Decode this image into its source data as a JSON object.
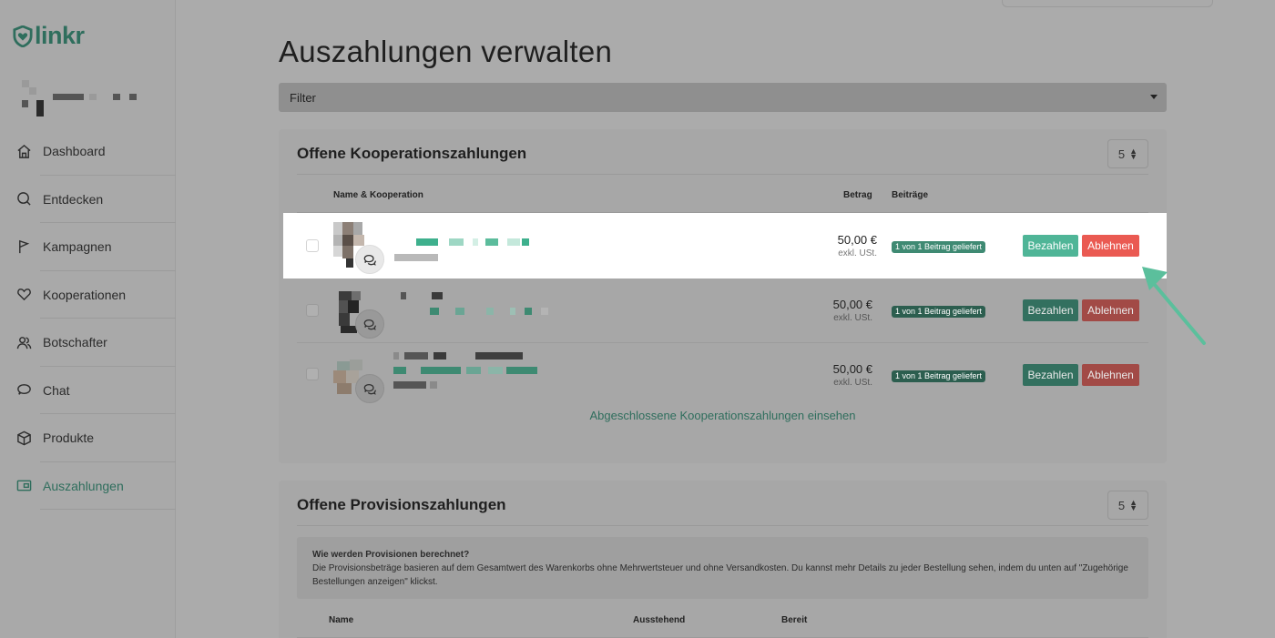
{
  "brand": {
    "name": "linkr",
    "color": "#2f6e5d"
  },
  "nav": [
    {
      "label": "Dashboard",
      "icon": "home-icon"
    },
    {
      "label": "Entdecken",
      "icon": "search-icon"
    },
    {
      "label": "Kampagnen",
      "icon": "flag-icon"
    },
    {
      "label": "Kooperationen",
      "icon": "heart-icon"
    },
    {
      "label": "Botschafter",
      "icon": "users-icon"
    },
    {
      "label": "Chat",
      "icon": "chat-icon"
    },
    {
      "label": "Produkte",
      "icon": "box-icon"
    },
    {
      "label": "Auszahlungen",
      "icon": "wallet-icon",
      "active": true
    }
  ],
  "page": {
    "title": "Auszahlungen verwalten",
    "filter_label": "Filter"
  },
  "cooperation_payments": {
    "title": "Offene Kooperationszahlungen",
    "page_size": "5",
    "headers": {
      "name": "Name & Kooperation",
      "amount": "Betrag",
      "posts": "Beiträge"
    },
    "rows": [
      {
        "amount": "50,00 €",
        "tax_note": "exkl. USt.",
        "posts_badge": "1 von 1 Beitrag geliefert",
        "pay_label": "Bezahlen",
        "reject_label": "Ablehnen"
      },
      {
        "amount": "50,00 €",
        "tax_note": "exkl. USt.",
        "posts_badge": "1 von 1 Beitrag geliefert",
        "pay_label": "Bezahlen",
        "reject_label": "Ablehnen"
      },
      {
        "amount": "50,00 €",
        "tax_note": "exkl. USt.",
        "posts_badge": "1 von 1 Beitrag geliefert",
        "pay_label": "Bezahlen",
        "reject_label": "Ablehnen"
      }
    ],
    "closed_link": "Abgeschlossene Kooperationszahlungen einsehen"
  },
  "commission_payments": {
    "title": "Offene Provisionszahlungen",
    "page_size": "5",
    "info_title": "Wie werden Provisionen berechnet?",
    "info_text": "Die Provisionsbeträge basieren auf dem Gesamtwert des Warenkorbs ohne Mehrwertsteuer und ohne Versandkosten. Du kannst mehr Details zu jeder Bestellung sehen, indem du unten auf \"Zugehörige Bestellungen anzeigen\" klickst.",
    "headers": {
      "name": "Name",
      "pending": "Ausstehend",
      "ready": "Bereit"
    }
  },
  "colors": {
    "pay": "#4fb597",
    "reject": "#ea5a52",
    "arrow": "#5bbf9c"
  }
}
